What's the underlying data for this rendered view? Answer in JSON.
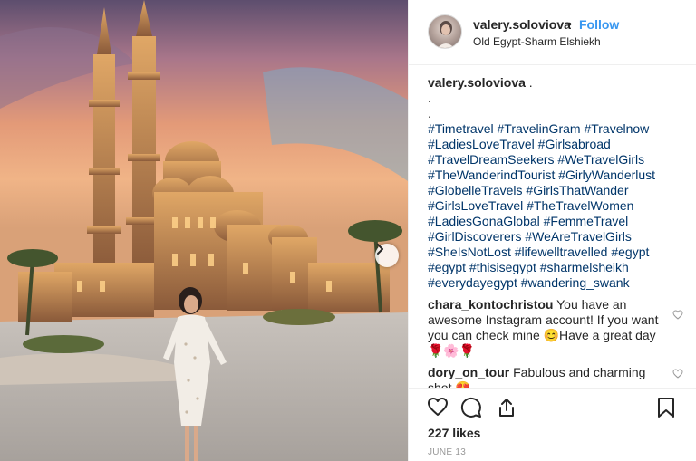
{
  "post": {
    "username": "valery.soloviova",
    "separator": "•",
    "follow_label": "Follow",
    "location": "Old Egypt-Sharm Elshiekh"
  },
  "caption": {
    "username": "valery.soloviova",
    "text_suffix": " .",
    "dots": [
      ".",
      "."
    ],
    "hashtag_lines": [
      "#Timetravel #TravelinGram #Travelnow",
      "#LadiesLoveTravel #Girlsabroad",
      "#TravelDreamSeekers #WeTravelGirls",
      "#TheWanderindTourist #GirlyWanderlust",
      "#GlobelleTravels #GirlsThatWander",
      "#GirlsLoveTravel #TheTravelWomen",
      "#LadiesGonaGlobal #FemmeTravel",
      "#GirlDiscoverers #WeAreTravelGirls",
      "#SheIsNotLost #lifewelltravelled #egypt",
      "#egypt #thisisegypt #sharmelsheikh",
      "#everydayegypt #wandering_swank"
    ]
  },
  "comments": [
    {
      "username": "chara_kontochristou",
      "text": " You have an awesome Instagram account! If you want you can check mine 😊Have a great day 🌹🌸🌹"
    },
    {
      "username": "dory_on_tour",
      "text": " Fabulous and charming shot 😍"
    }
  ],
  "likes": "227 likes",
  "date": "JUNE 13",
  "icons": {
    "like": "heart-icon",
    "comment": "comment-icon",
    "share": "share-icon",
    "save": "bookmark-icon",
    "carousel": "chevron-right-icon"
  },
  "colors": {
    "follow": "#3897f0",
    "hashtag": "#003569",
    "text": "#262626",
    "muted": "#999999"
  }
}
